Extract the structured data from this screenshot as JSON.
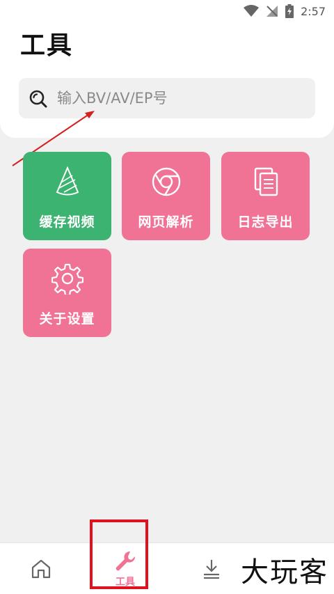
{
  "status_bar": {
    "time": "2:57",
    "icons": [
      "wifi-icon",
      "no-signal-icon",
      "battery-charging-icon"
    ]
  },
  "header": {
    "title": "工具"
  },
  "search": {
    "placeholder": "输入BV/AV/EP号",
    "icon": "search-icon"
  },
  "tools": [
    {
      "label": "缓存视频",
      "icon": "zongzi-icon",
      "color": "#3cb371"
    },
    {
      "label": "网页解析",
      "icon": "chrome-icon",
      "color": "#f07396"
    },
    {
      "label": "日志导出",
      "icon": "documents-icon",
      "color": "#f07396"
    },
    {
      "label": "关于设置",
      "icon": "gear-icon",
      "color": "#f07396"
    }
  ],
  "bottom_nav": {
    "items": [
      {
        "name": "home",
        "icon": "home-icon",
        "label": ""
      },
      {
        "name": "tools",
        "icon": "wrench-icon",
        "label": "工具",
        "active": true
      },
      {
        "name": "download",
        "icon": "download-icon",
        "label": ""
      }
    ]
  },
  "watermark": {
    "text": "大玩客"
  },
  "colors": {
    "accent_pink": "#f07396",
    "accent_green": "#3cb371",
    "annotation_red": "#e0101c"
  }
}
